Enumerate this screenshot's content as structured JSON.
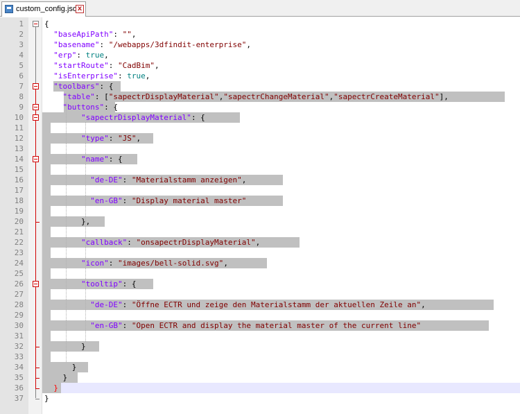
{
  "tab": {
    "title": "custom_config.json",
    "close": "x"
  },
  "lines": [
    {
      "n": "1",
      "t": "{"
    },
    {
      "n": "2",
      "t": "  \"baseApiPath\": \"\","
    },
    {
      "n": "3",
      "t": "  \"basename\": \"/webapps/3dfindit-enterprise\","
    },
    {
      "n": "4",
      "t": "  \"erp\": true,"
    },
    {
      "n": "5",
      "t": "  \"startRoute\": \"CadBim\","
    },
    {
      "n": "6",
      "t": "  \"isEnterprise\": true,"
    },
    {
      "n": "7",
      "t": "  \"toolbars\": {"
    },
    {
      "n": "8",
      "t": "    \"table\": [\"sapectrDisplayMaterial\",\"sapectrChangeMaterial\",\"sapectrCreateMaterial\"],"
    },
    {
      "n": "9",
      "t": "    \"buttons\": {"
    },
    {
      "n": "10",
      "t": "        \"sapectrDisplayMaterial\": {"
    },
    {
      "n": "11",
      "t": ""
    },
    {
      "n": "12",
      "t": "        \"type\": \"JS\","
    },
    {
      "n": "13",
      "t": ""
    },
    {
      "n": "14",
      "t": "        \"name\": {"
    },
    {
      "n": "15",
      "t": ""
    },
    {
      "n": "16",
      "t": "          \"de-DE\": \"Materialstamm anzeigen\","
    },
    {
      "n": "17",
      "t": ""
    },
    {
      "n": "18",
      "t": "          \"en-GB\": \"Display material master\""
    },
    {
      "n": "19",
      "t": ""
    },
    {
      "n": "20",
      "t": "        },"
    },
    {
      "n": "21",
      "t": ""
    },
    {
      "n": "22",
      "t": "        \"callback\": \"onsapectrDisplayMaterial\","
    },
    {
      "n": "23",
      "t": ""
    },
    {
      "n": "24",
      "t": "        \"icon\": \"images/bell-solid.svg\","
    },
    {
      "n": "25",
      "t": ""
    },
    {
      "n": "26",
      "t": "        \"tooltip\": {"
    },
    {
      "n": "27",
      "t": ""
    },
    {
      "n": "28",
      "t": "          \"de-DE\": \"Öffne ECTR und zeige den Materialstamm der aktuellen Zeile an\","
    },
    {
      "n": "29",
      "t": ""
    },
    {
      "n": "30",
      "t": "          \"en-GB\": \"Open ECTR and display the material master of the current line\""
    },
    {
      "n": "31",
      "t": ""
    },
    {
      "n": "32",
      "t": "        }"
    },
    {
      "n": "33",
      "t": ""
    },
    {
      "n": "34",
      "t": "      }"
    },
    {
      "n": "35",
      "t": "    }"
    },
    {
      "n": "36",
      "t": "  }"
    },
    {
      "n": "37",
      "t": "}"
    }
  ]
}
